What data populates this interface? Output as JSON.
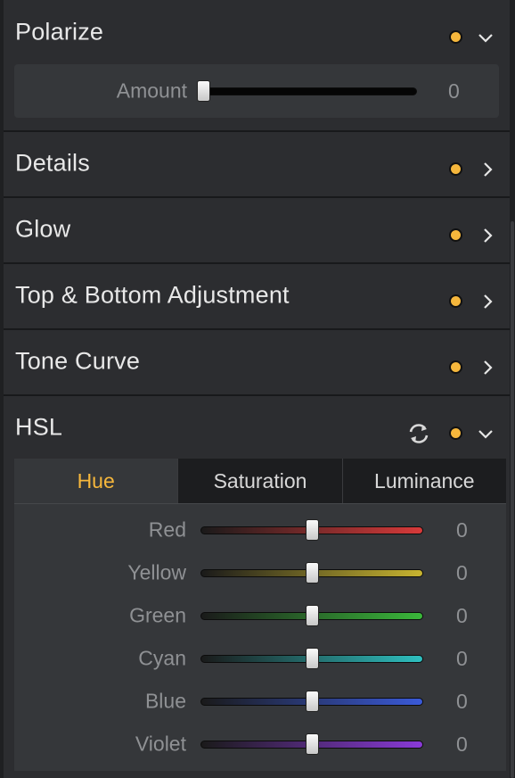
{
  "sections": [
    {
      "title": "Polarize",
      "expanded": true
    },
    {
      "title": "Details",
      "expanded": false
    },
    {
      "title": "Glow",
      "expanded": false
    },
    {
      "title": "Top & Bottom Adjustment",
      "expanded": false
    },
    {
      "title": "Tone Curve",
      "expanded": false
    },
    {
      "title": "HSL",
      "expanded": true
    }
  ],
  "polarize": {
    "amount_label": "Amount",
    "amount_value": "0",
    "amount_fraction": 0.0
  },
  "hsl": {
    "tabs": [
      {
        "label": "Hue",
        "active": true
      },
      {
        "label": "Saturation",
        "active": false
      },
      {
        "label": "Luminance",
        "active": false
      }
    ],
    "rows": [
      {
        "label": "Red",
        "value": "0",
        "position": 0.5,
        "color": "#d83a3a"
      },
      {
        "label": "Yellow",
        "value": "0",
        "position": 0.5,
        "color": "#c8b430"
      },
      {
        "label": "Green",
        "value": "0",
        "position": 0.5,
        "color": "#3ab83a"
      },
      {
        "label": "Cyan",
        "value": "0",
        "position": 0.5,
        "color": "#2ec0c0"
      },
      {
        "label": "Blue",
        "value": "0",
        "position": 0.5,
        "color": "#3a5ad8"
      },
      {
        "label": "Violet",
        "value": "0",
        "position": 0.5,
        "color": "#8a3ad8"
      }
    ]
  },
  "colors": {
    "accent": "#f6b73c",
    "panel": "#2c2d30",
    "subpanel": "#35373a"
  },
  "icons": {
    "enabled": "orange-dot-icon",
    "expanded": "chevron-down-icon",
    "collapsed": "chevron-right-icon",
    "reset": "sync-icon"
  }
}
